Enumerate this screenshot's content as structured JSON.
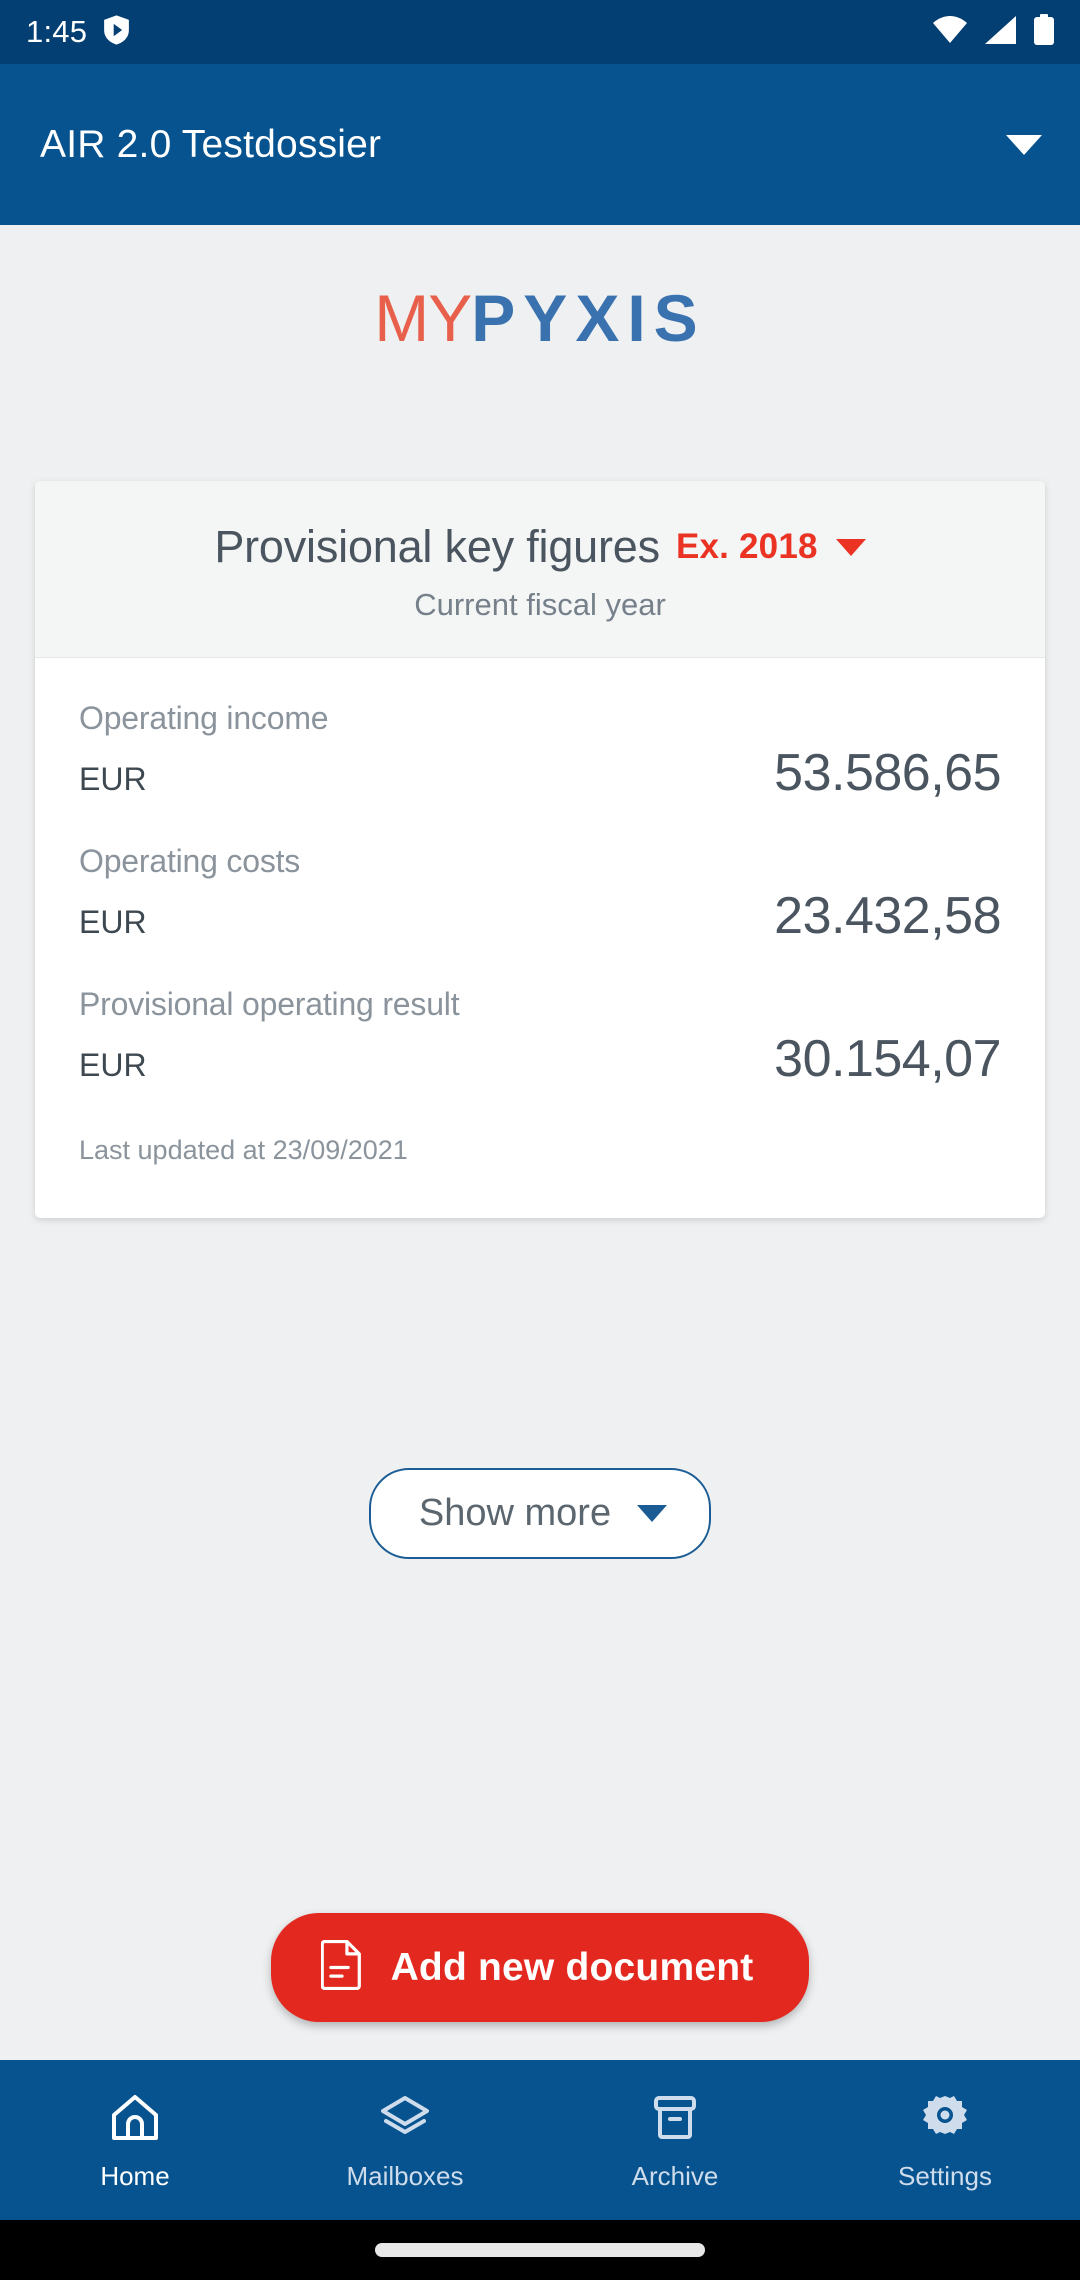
{
  "status_bar": {
    "time": "1:45",
    "icons": [
      "shield-play-icon",
      "wifi-icon",
      "cellular-signal-icon",
      "battery-icon"
    ]
  },
  "app_bar": {
    "title": "AIR 2.0 Testdossier",
    "dropdown_icon": "chevron-down-icon"
  },
  "logo": {
    "part1": "MY",
    "part2": "PYXIS",
    "part1_color": "#e8604c",
    "part2_color": "#3a72b0"
  },
  "card": {
    "title": "Provisional key figures",
    "period": "Ex. 2018",
    "period_color": "#ea3323",
    "period_dropdown_icon": "caret-down-icon",
    "subtitle": "Current fiscal year",
    "figures": [
      {
        "label": "Operating income",
        "currency": "EUR",
        "value": "53.586,65"
      },
      {
        "label": "Operating costs",
        "currency": "EUR",
        "value": "23.432,58"
      },
      {
        "label": "Provisional operating result",
        "currency": "EUR",
        "value": "30.154,07"
      }
    ],
    "last_updated": "Last updated at 23/09/2021"
  },
  "show_more": {
    "label": "Show more",
    "icon": "caret-down-icon",
    "border_color": "#1c5c95"
  },
  "fab": {
    "label": "Add new document",
    "icon": "document-icon",
    "background": "#e3281f"
  },
  "bottom_nav": {
    "background": "#06538f",
    "items": [
      {
        "label": "Home",
        "icon": "home-icon",
        "active": true
      },
      {
        "label": "Mailboxes",
        "icon": "layers-icon",
        "active": false
      },
      {
        "label": "Archive",
        "icon": "archive-box-icon",
        "active": false
      },
      {
        "label": "Settings",
        "icon": "gear-icon",
        "active": false
      }
    ]
  }
}
